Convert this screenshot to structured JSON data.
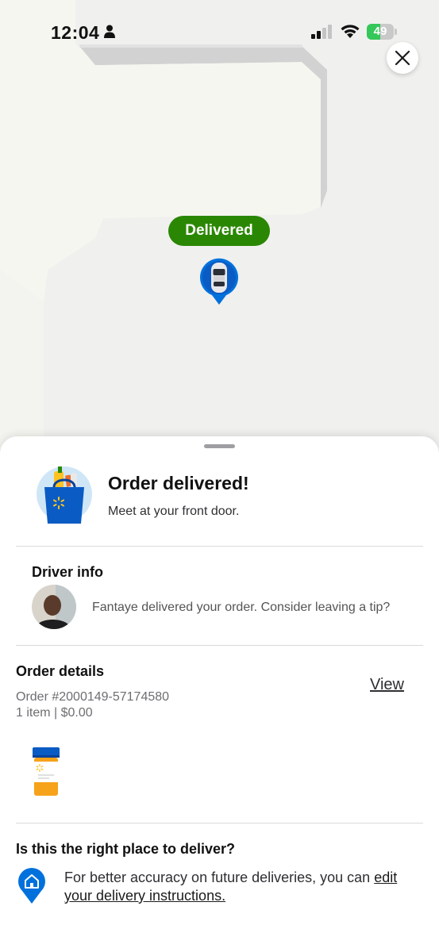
{
  "status_bar": {
    "time": "12:04",
    "battery_percent": "49",
    "battery_level": 0.49
  },
  "map": {
    "status_pill": "Delivered"
  },
  "sheet": {
    "order_title": "Order delivered!",
    "order_subtitle": "Meet at your front door.",
    "driver_heading": "Driver info",
    "driver_message": "Fantaye delivered your order. Consider leaving a tip?",
    "details_heading": "Order details",
    "view_link": "View",
    "order_number": "Order #2000149-57174580",
    "order_summary": "1 item | $0.00",
    "place_heading": "Is this the right place to deliver?",
    "place_text": "For better accuracy on future deliveries, you can",
    "place_link": "edit your delivery instructions."
  },
  "colors": {
    "walmart_green": "#2a8703",
    "walmart_blue": "#0071dc",
    "walmart_yellow": "#ffc220"
  },
  "icons": [
    "person-icon",
    "signal-icon",
    "wifi-icon",
    "battery-icon",
    "close-icon",
    "car-pin-icon",
    "grocery-bag-icon",
    "pill-bottle-icon",
    "home-pin-icon"
  ]
}
